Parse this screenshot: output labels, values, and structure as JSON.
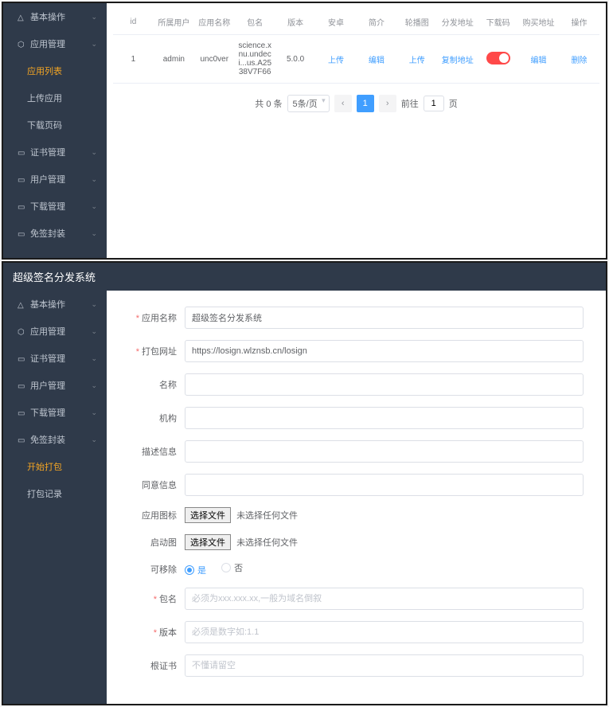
{
  "top": {
    "sidebar": [
      {
        "label": "基本操作",
        "icon": "△",
        "expand": true
      },
      {
        "label": "应用管理",
        "icon": "⬡",
        "expand": true,
        "active": false
      },
      {
        "label": "应用列表",
        "sub": true,
        "active": true
      },
      {
        "label": "上传应用",
        "sub": true
      },
      {
        "label": "下载页码",
        "sub": true
      },
      {
        "label": "证书管理",
        "icon": "▭",
        "expand": true
      },
      {
        "label": "用户管理",
        "icon": "▭",
        "expand": true
      },
      {
        "label": "下载管理",
        "icon": "▭",
        "expand": true
      },
      {
        "label": "免签封装",
        "icon": "▭",
        "expand": true
      }
    ],
    "table": {
      "headers": [
        "id",
        "所属用户",
        "应用名称",
        "包名",
        "版本",
        "安卓",
        "简介",
        "轮播图",
        "分发地址",
        "下载码",
        "购买地址",
        "操作"
      ],
      "row": {
        "id": "1",
        "user": "admin",
        "name": "unc0ver",
        "pkg": "science.xnu.undeci...us.A2538V7F66",
        "ver": "5.0.0",
        "android": "上传",
        "intro": "编辑",
        "carousel": "上传",
        "dist": "复制地址",
        "buy": "编辑",
        "op": "删除"
      }
    },
    "pager": {
      "total": "共 0 条",
      "size": "5条/页",
      "page": "1",
      "goto": "前往",
      "gotoVal": "1",
      "unit": "页"
    }
  },
  "bottom": {
    "title": "超级签名分发系统",
    "sidebar": [
      {
        "label": "基本操作",
        "icon": "△",
        "expand": true
      },
      {
        "label": "应用管理",
        "icon": "⬡",
        "expand": true
      },
      {
        "label": "证书管理",
        "icon": "▭",
        "expand": true
      },
      {
        "label": "用户管理",
        "icon": "▭",
        "expand": true
      },
      {
        "label": "下载管理",
        "icon": "▭",
        "expand": true
      },
      {
        "label": "免签封装",
        "icon": "▭",
        "expand": true
      },
      {
        "label": "开始打包",
        "sub": true,
        "active": true
      },
      {
        "label": "打包记录",
        "sub": true
      }
    ],
    "form": {
      "appName": {
        "label": "应用名称",
        "value": "超级签名分发系统"
      },
      "buildUrl": {
        "label": "打包网址",
        "value": "https://losign.wlznsb.cn/losign"
      },
      "name": {
        "label": "名称"
      },
      "org": {
        "label": "机构"
      },
      "desc": {
        "label": "描述信息"
      },
      "disclaimer": {
        "label": "同意信息"
      },
      "appIcon": {
        "label": "应用图标",
        "btn": "选择文件",
        "txt": "未选择任何文件"
      },
      "launch": {
        "label": "启动图",
        "btn": "选择文件",
        "txt": "未选择任何文件"
      },
      "removable": {
        "label": "可移除",
        "yes": "是",
        "no": "否"
      },
      "pkg": {
        "label": "包名",
        "placeholder": "必须为xxx.xxx.xx,一般为域名倒叙"
      },
      "ver": {
        "label": "版本",
        "placeholder": "必须是数字如:1.1"
      },
      "rootCert": {
        "label": "根证书",
        "placeholder": "不懂请留空"
      }
    }
  }
}
